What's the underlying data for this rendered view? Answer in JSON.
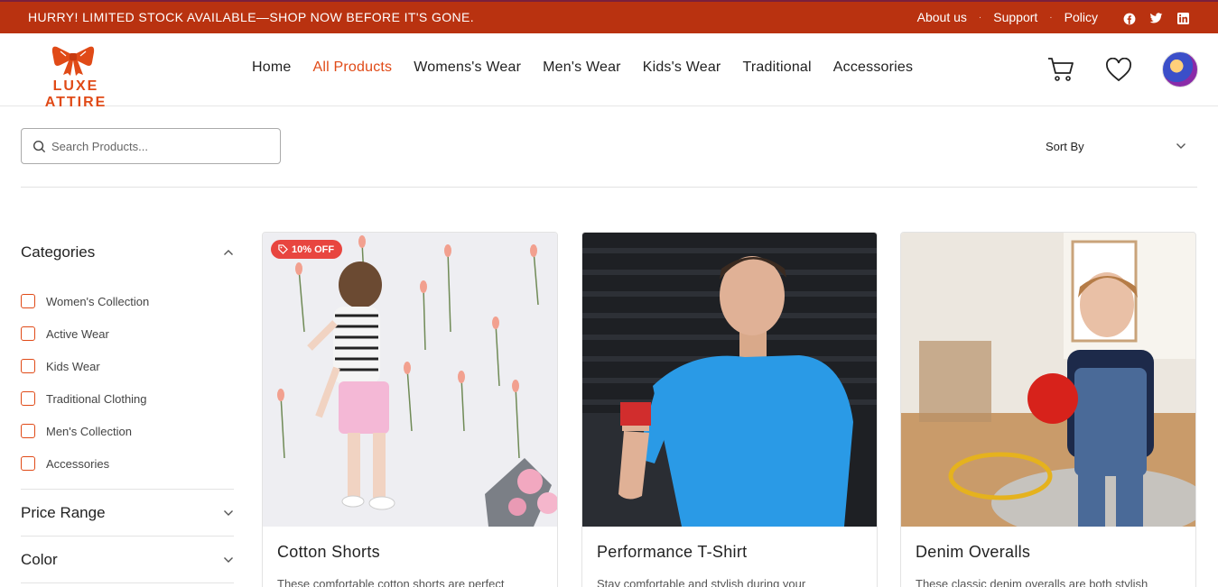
{
  "announcement": {
    "message": "HURRY! LIMITED STOCK AVAILABLE—SHOP NOW BEFORE IT'S GONE.",
    "links": [
      "About us",
      "Support",
      "Policy"
    ],
    "social": [
      "facebook-icon",
      "twitter-icon",
      "linkedin-icon"
    ],
    "bg_color": "#b93210"
  },
  "brand": {
    "name": "LUXE ATTIRE",
    "accent": "#e04a17"
  },
  "nav": [
    "Home",
    "All Products",
    "Womens's Wear",
    "Men's Wear",
    "Kids's Wear",
    "Traditional",
    "Accessories"
  ],
  "nav_active": "All Products",
  "header_icons": [
    "cart-icon",
    "heart-icon",
    "avatar"
  ],
  "search": {
    "placeholder": "Search Products..."
  },
  "sort": {
    "label": "Sort By"
  },
  "filters": {
    "categories_title": "Categories",
    "categories": [
      "Women's Collection",
      "Active Wear",
      "Kids Wear",
      "Traditional Clothing",
      "Men's Collection",
      "Accessories"
    ],
    "price_title": "Price Range",
    "color_title": "Color"
  },
  "products": [
    {
      "name": "Cotton Shorts",
      "desc": "These comfortable cotton shorts are perfect",
      "badge": "10% OFF"
    },
    {
      "name": "Performance T-Shirt",
      "desc": "Stay comfortable and stylish during your",
      "badge": ""
    },
    {
      "name": "Denim Overalls",
      "desc": "These classic denim overalls are both stylish",
      "badge": ""
    }
  ]
}
